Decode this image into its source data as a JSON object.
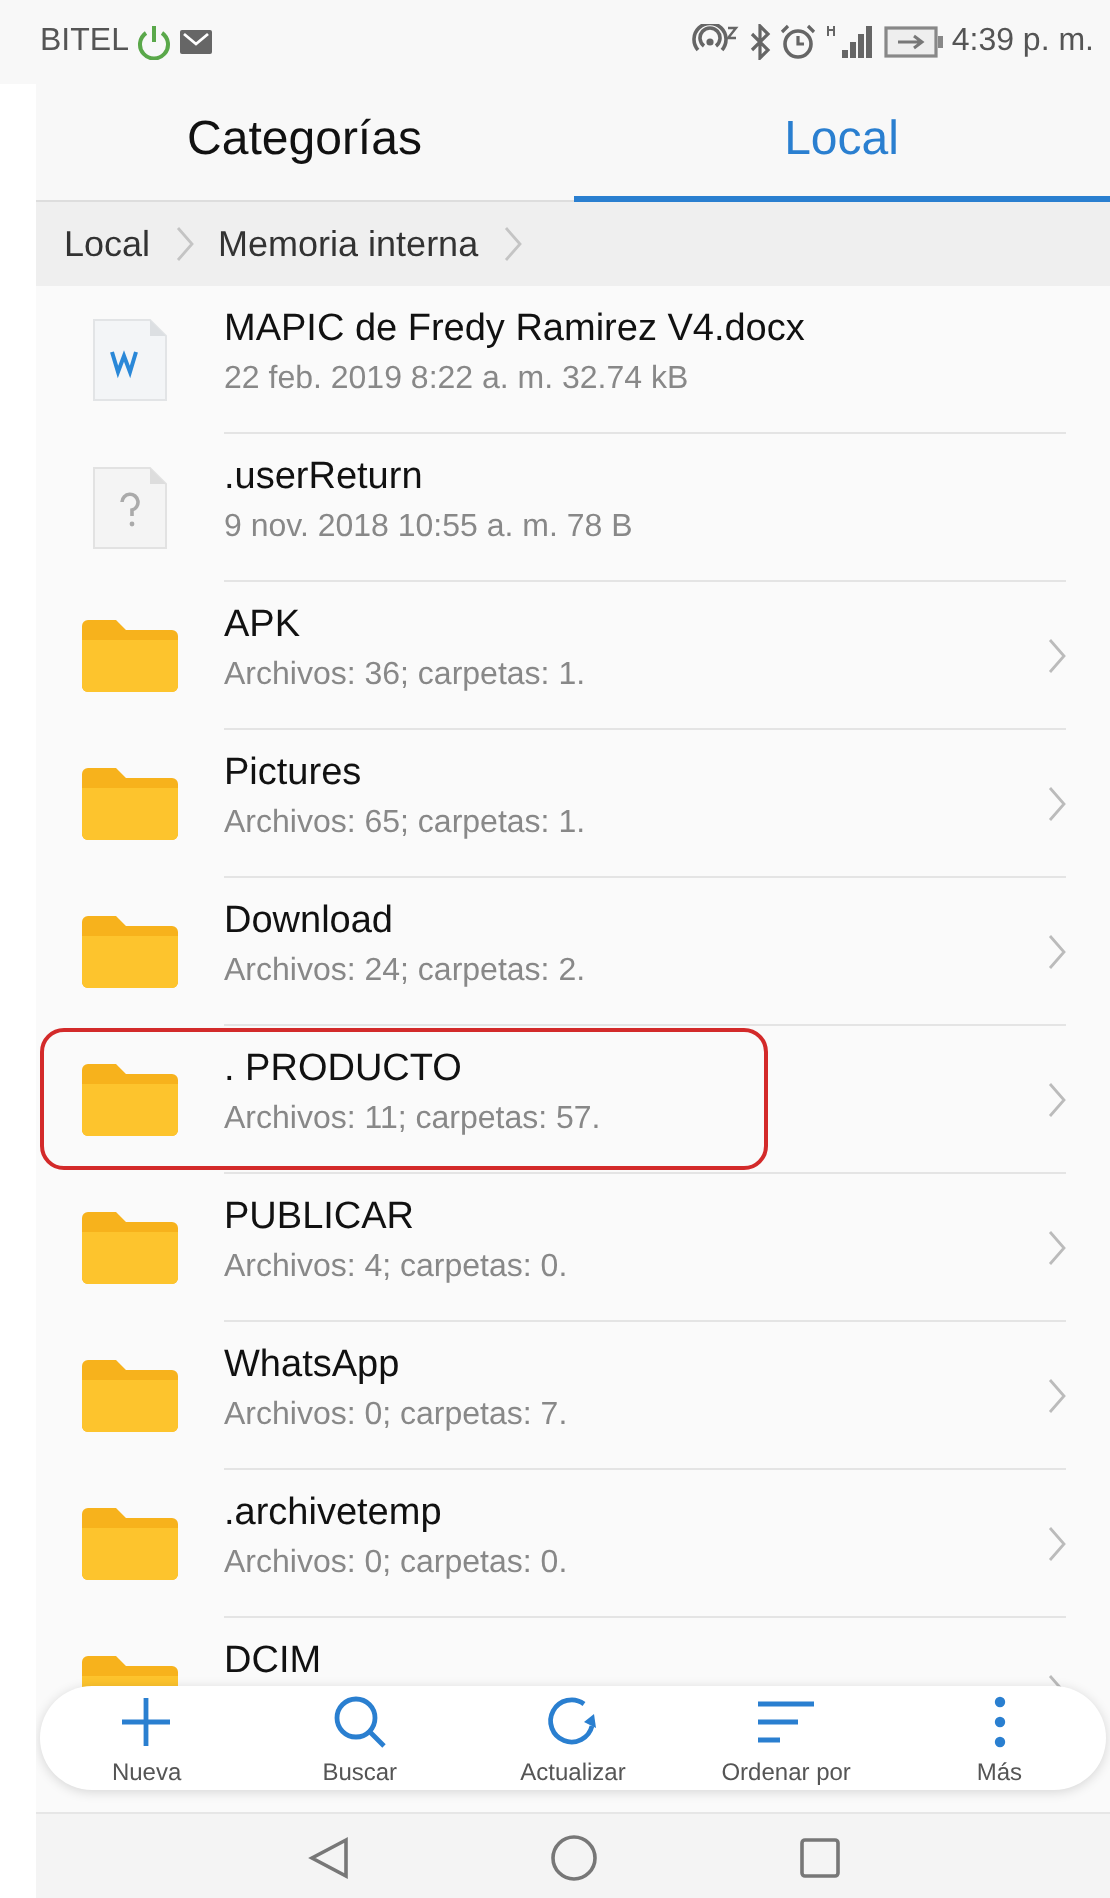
{
  "status_bar": {
    "carrier": "BITEL",
    "time": "4:39 p. m."
  },
  "tabs": [
    {
      "label": "Categorías",
      "selected": false
    },
    {
      "label": "Local",
      "selected": true
    }
  ],
  "breadcrumb": [
    "Local",
    "Memoria interna"
  ],
  "files": [
    {
      "kind": "doc",
      "name": "MAPIC de Fredy Ramirez V4.docx",
      "details": "22 feb. 2019 8:22 a. m. 32.74 kB",
      "highlighted": false
    },
    {
      "kind": "unknown",
      "name": ".userReturn",
      "details": "9 nov. 2018 10:55 a. m. 78 B",
      "highlighted": false
    },
    {
      "kind": "folder",
      "name": "APK",
      "details": "Archivos: 36; carpetas: 1.",
      "highlighted": false
    },
    {
      "kind": "folder",
      "name": "Pictures",
      "details": "Archivos: 65; carpetas: 1.",
      "highlighted": false
    },
    {
      "kind": "folder",
      "name": "Download",
      "details": "Archivos: 24; carpetas: 2.",
      "highlighted": false
    },
    {
      "kind": "folder",
      "name": ". PRODUCTO",
      "details": "Archivos: 11; carpetas: 57.",
      "highlighted": true
    },
    {
      "kind": "folder",
      "name": "PUBLICAR",
      "details": "Archivos: 4; carpetas: 0.",
      "highlighted": false
    },
    {
      "kind": "folder",
      "name": "WhatsApp",
      "details": "Archivos: 0; carpetas: 7.",
      "highlighted": false
    },
    {
      "kind": "folder",
      "name": ".archivetemp",
      "details": "Archivos: 0; carpetas: 0.",
      "highlighted": false
    },
    {
      "kind": "folder",
      "name": "DCIM",
      "highlighted": false
    }
  ],
  "toolbar": [
    {
      "kind": "add",
      "label": "Nueva"
    },
    {
      "kind": "search",
      "label": "Buscar"
    },
    {
      "kind": "refresh",
      "label": "Actualizar"
    },
    {
      "kind": "sort",
      "label": "Ordenar por"
    },
    {
      "kind": "more",
      "label": "Más"
    }
  ]
}
